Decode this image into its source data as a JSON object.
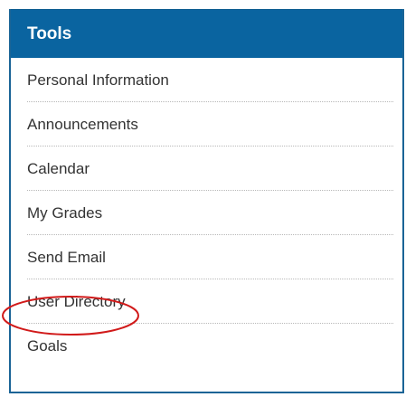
{
  "panel": {
    "title": "Tools",
    "items": [
      {
        "label": "Personal Information"
      },
      {
        "label": "Announcements"
      },
      {
        "label": "Calendar"
      },
      {
        "label": "My Grades"
      },
      {
        "label": "Send Email"
      },
      {
        "label": "User Directory",
        "highlighted": true
      },
      {
        "label": "Goals"
      }
    ]
  },
  "colors": {
    "header_bg": "#0a64a0",
    "header_text": "#ffffff",
    "item_text": "#333333",
    "highlight_ring": "#d11a1a"
  }
}
